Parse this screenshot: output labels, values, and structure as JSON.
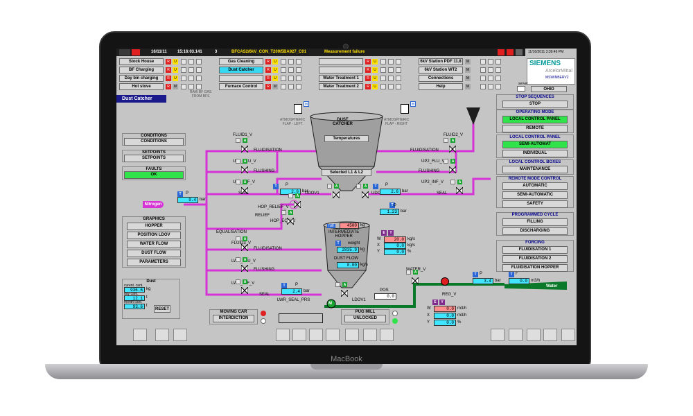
{
  "device": {
    "brand": "MacBook"
  },
  "header": {
    "date": "16/11/11",
    "time": "15:16:03.141",
    "count": "3",
    "alarm_code": "BFCAS2/6kV_CON_T209/5BA927_C01",
    "alarm_text": "Measurement failure",
    "clock": "11/16/2011 3:39:46 PM"
  },
  "nav": {
    "col1": [
      "Stock House",
      "BF Charging",
      "Day bin charging",
      "Hot stove"
    ],
    "col2": [
      "Gas Cleaning",
      "Dust Catcher",
      "",
      "Furnace Control"
    ],
    "col3": [
      "",
      "",
      "Water Treatment 1",
      "Water Treatment 2"
    ],
    "col4": [
      "6kV Station PDF 11.8",
      "6kV Station WT2",
      "Connections",
      "Help"
    ],
    "status_letters": {
      "r": "R",
      "u": "U",
      "m": "M"
    }
  },
  "logo": {
    "siemens": "SIEMENS",
    "arcelor": "ArcelorMittal",
    "host": "MSWINBERV2",
    "server_label": "server",
    "server_name": "OHIO"
  },
  "page_title": "Dust Catcher",
  "left_panel": {
    "conditions_title": "CONDITIONS",
    "conditions_btn": "CONDITIONS",
    "setpoints_title": "SETPOINTS",
    "setpoints_btn": "SETPOINTS",
    "faults_title": "FAULTS",
    "faults_btn": "OK",
    "graphics_title": "GRAPHICS",
    "graphics": [
      "HOPPER",
      "POSITION LDOV",
      "WATER FLOW",
      "DUST FLOW",
      "PARAMETERS"
    ],
    "dust_title": "Dust",
    "dust_rows": [
      {
        "label": "curent. cant.",
        "value": "936.6",
        "unit": "kg"
      },
      {
        "label": "day cant.",
        "value": "12.1",
        "unit": "t"
      },
      {
        "label": "month cant.",
        "value": "93.6",
        "unit": "t"
      }
    ],
    "reset": "RESET"
  },
  "right_panel": {
    "stop_title": "STOP SEQUENCES",
    "stop_btn": "STOP",
    "op_title": "OPERATING MODE",
    "op_btns": [
      "LOCAL CONTROL PANEL",
      "REMOTE"
    ],
    "lcp_title": "LOCAL CONTROL PANEL",
    "lcp_btns": [
      "SEMI-AUTOMAT",
      "INDIVIDUAL"
    ],
    "lcb_title": "LOCAL CONTROL BOXES",
    "lcb_btns": [
      "MAINTENANCE"
    ],
    "rm_title": "REMOTE MODE CONTROL",
    "rm_btns": [
      "AUTOMATIC",
      "SEMI-AUTOMATIC",
      "SAFETY"
    ],
    "pc_title": "PROGRAMMED CYCLE",
    "pc_btns": [
      "FILLING",
      "DISCHARGING"
    ],
    "forcing_title": "FORCING",
    "forcing_btns": [
      "FLUIDISATION 1",
      "FLUIDISATION 2",
      "FLUIDISATION HOPPER"
    ]
  },
  "process": {
    "raw_gas": "RAW BF GAS\nFROM BFS",
    "dust_catcher": "DUST\nCATCHER",
    "temperatures": "Temperatures",
    "selected": "Selected L1 & L2",
    "atm_left": "ATMOSPHERIC\nFLAP - LEFT",
    "atm_right": "ATMOSPHERIC\nFLAP - RIGHT",
    "fluid1": "FLUID1_V",
    "fluid2": "FLUID2_V",
    "fluidisation": "FLUIDISATION",
    "up1_flu": "UP1_FLU_V",
    "up2_flu": "UP2_FLU_V",
    "flushing": "FLUSHING",
    "up1_inf": "UP1_INF_V",
    "up2_inf": "UP2_INF_V",
    "seal": "SEAL",
    "udov1": "UDOV1",
    "udov2": "UDOV2",
    "p_label": "P",
    "p1": "2.6",
    "p2": "2.6",
    "p_unit": "bar",
    "nitrogen": "Nitrogen",
    "nitrogen_p": "9.4",
    "nitrogen_unit": "bar",
    "hop_relief": "HOP_RELIEF_V",
    "relief": "RELIEF",
    "hop_eqv": "HOP_EQV_V",
    "equalisation": "EQUALISATION",
    "hopper_p": "1.23",
    "hopper_p_unit": "bar",
    "full_label": "full",
    "full_value": "4500",
    "full_unit": "kg",
    "intermediate": "INTERMEDIATE\nHOPPER",
    "weight_label": "weight",
    "weight_value": "2835.9",
    "weight_unit": "kg",
    "w_value": "20.0",
    "w_unit": "kg/s",
    "x_value": "0.0",
    "x_unit": "kg/s",
    "y_value": "0.0",
    "y_unit": "%",
    "dust_flow_label": "DUST FLOW",
    "dust_flow_value": "0.00",
    "dust_flow_unit": "kg/s",
    "fluid3": "FLUID3_V",
    "lwr_flu": "LWR_FLU_V",
    "lwr_inf": "LWR_INF_V",
    "lwr_p": "2.4",
    "lwr_seal": "LWR_SEAL_PRS",
    "ldov1": "LDOV1",
    "pos_label": "POS",
    "pos_value": "0.0",
    "water_v": "WATER_V",
    "reg_v": "REG_V",
    "water_p": "3.4",
    "water_f": "0.0",
    "water_f_unit": "m3/h",
    "water": "Water",
    "reg_w": "0.0",
    "reg_w_unit": "m3/h",
    "reg_x": "0.0",
    "reg_x_unit": "m3/h",
    "reg_y": "0.0",
    "reg_y_unit": "%",
    "m_label": "M",
    "moving_car": "MOVING CAR",
    "interdiction": "INTERDICTION",
    "pug_mill": "PUG MILL",
    "unlocked": "UNLOCKED",
    "tag_t": "T",
    "tag_a": "A",
    "tag_f": "F",
    "tag_e": "E",
    "tag_y": "Y",
    "tag_h": "H",
    "w_letter": "W",
    "x_letter": "X",
    "y_letter": "Y"
  }
}
